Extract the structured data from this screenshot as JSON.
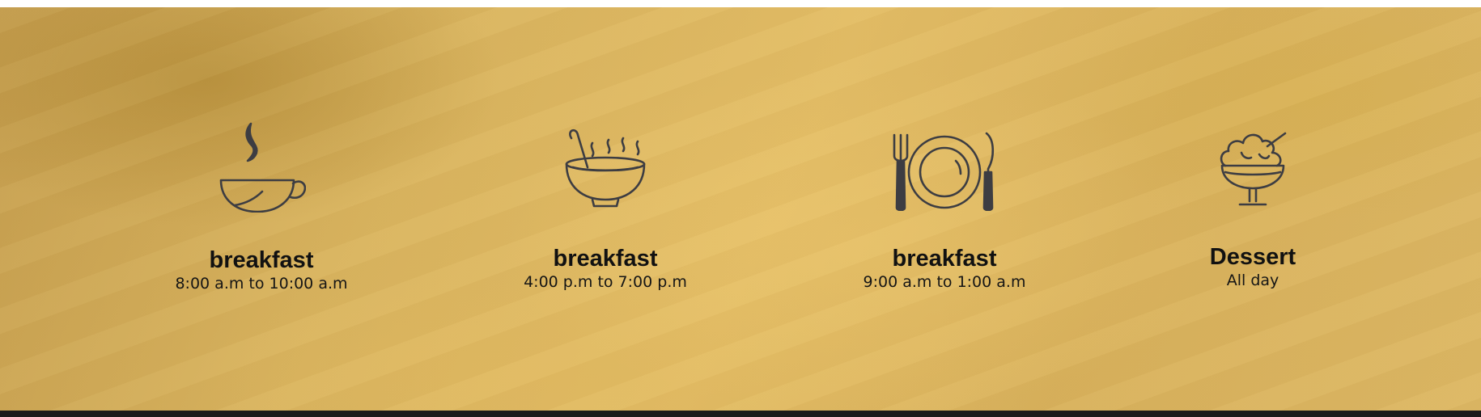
{
  "menu_times": {
    "items": [
      {
        "icon": "coffee-cup-icon",
        "title": "breakfast",
        "time": "8:00 a.m to 10:00 a.m"
      },
      {
        "icon": "soup-bowl-icon",
        "title": "breakfast",
        "time": "4:00 p.m to 7:00 p.m"
      },
      {
        "icon": "plate-fork-knife-icon",
        "title": "breakfast",
        "time": "9:00 a.m to 1:00 a.m"
      },
      {
        "icon": "ice-cream-sundae-icon",
        "title": "Dessert",
        "time": "All day"
      }
    ]
  },
  "colors": {
    "background_gold": "#d9b45f",
    "icon_stroke": "#3d3d42",
    "text": "#111111",
    "footer_bar": "#1b1b1b"
  }
}
